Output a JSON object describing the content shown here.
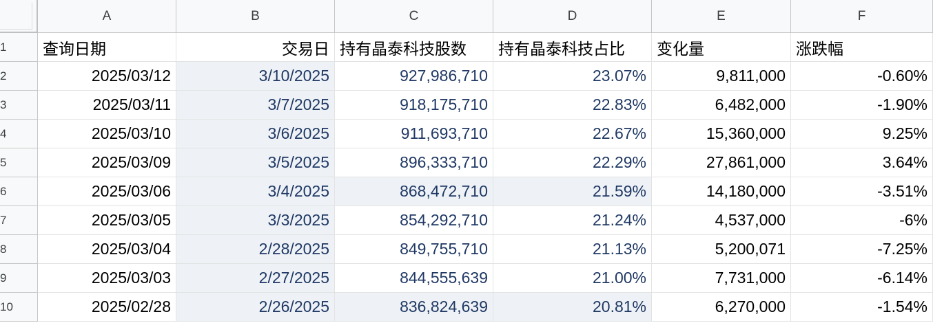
{
  "columns": [
    "A",
    "B",
    "C",
    "D",
    "E",
    "F"
  ],
  "row_numbers": [
    "1",
    "2",
    "3",
    "4",
    "5",
    "6",
    "7",
    "8",
    "9",
    "10"
  ],
  "header": [
    "查询日期",
    "交易日",
    "持有晶泰科技股数",
    "持有晶泰科技占比",
    "变化量",
    "涨跌幅"
  ],
  "rows": [
    [
      "2025/03/12",
      "3/10/2025",
      "927,986,710",
      "23.07%",
      "9,811,000",
      "-0.60%"
    ],
    [
      "2025/03/11",
      "3/7/2025",
      "918,175,710",
      "22.83%",
      "6,482,000",
      "-1.90%"
    ],
    [
      "2025/03/10",
      "3/6/2025",
      "911,693,710",
      "22.67%",
      "15,360,000",
      "9.25%"
    ],
    [
      "2025/03/09",
      "3/5/2025",
      "896,333,710",
      "22.29%",
      "27,861,000",
      "3.64%"
    ],
    [
      "2025/03/06",
      "3/4/2025",
      "868,472,710",
      "21.59%",
      "14,180,000",
      "-3.51%"
    ],
    [
      "2025/03/05",
      "3/3/2025",
      "854,292,710",
      "21.24%",
      "4,537,000",
      "-6%"
    ],
    [
      "2025/03/04",
      "2/28/2025",
      "849,755,710",
      "21.13%",
      "5,200,071",
      "-7.25%"
    ],
    [
      "2025/03/03",
      "2/27/2025",
      "844,555,639",
      "21.00%",
      "7,731,000",
      "-6.14%"
    ],
    [
      "2025/02/28",
      "2/26/2025",
      "836,824,639",
      "20.81%",
      "6,270,000",
      "-1.54%"
    ]
  ],
  "colors": {
    "data_blue": "#1f3864",
    "shade": "#eef2f6",
    "header_bg": "#f8f9fa"
  }
}
